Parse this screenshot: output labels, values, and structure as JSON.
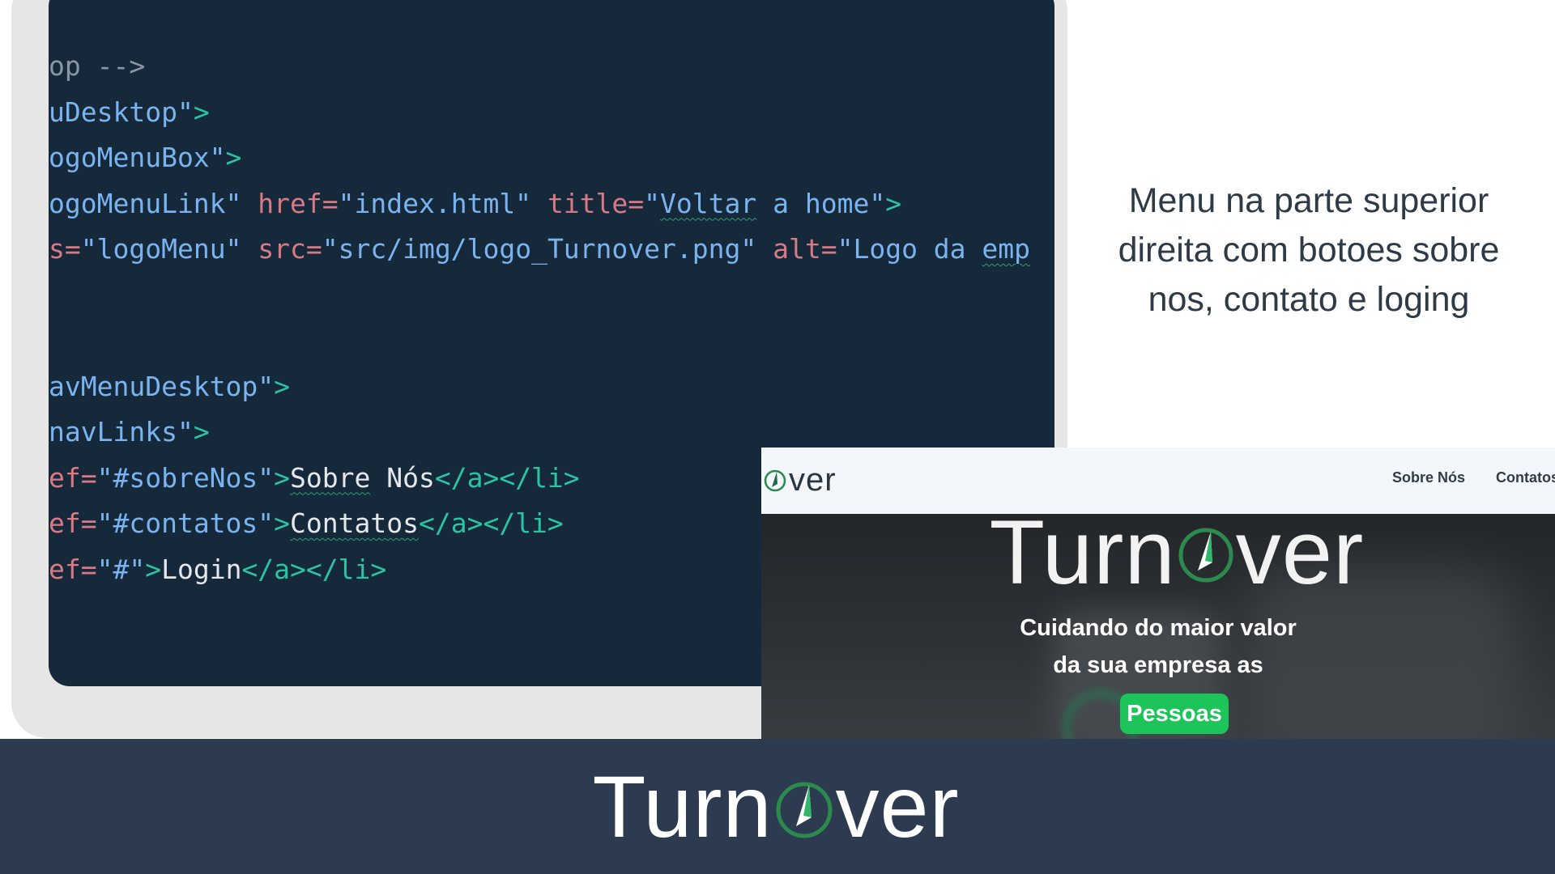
{
  "code_editor": {
    "lines": [
      [
        {
          "t": "comment",
          "v": "op -->"
        }
      ],
      [
        {
          "t": "str",
          "v": "uDesktop\""
        },
        {
          "t": "tag",
          "v": ">"
        }
      ],
      [
        {
          "t": "str",
          "v": "ogoMenuBox\""
        },
        {
          "t": "tag",
          "v": ">"
        }
      ],
      [
        {
          "t": "str",
          "v": "ogoMenuLink\""
        },
        {
          "t": "text",
          "v": " "
        },
        {
          "t": "attr",
          "v": "href="
        },
        {
          "t": "str",
          "v": "\"index.html\""
        },
        {
          "t": "text",
          "v": " "
        },
        {
          "t": "attr",
          "v": "title="
        },
        {
          "t": "str",
          "v": "\""
        },
        {
          "t": "str",
          "v": "Voltar",
          "sq": true
        },
        {
          "t": "str",
          "v": " a home\""
        },
        {
          "t": "tag",
          "v": ">"
        }
      ],
      [
        {
          "t": "attr",
          "v": "s="
        },
        {
          "t": "str",
          "v": "\"logoMenu\""
        },
        {
          "t": "text",
          "v": " "
        },
        {
          "t": "attr",
          "v": "src="
        },
        {
          "t": "str",
          "v": "\"src/img/logo_Turnover.png\""
        },
        {
          "t": "text",
          "v": " "
        },
        {
          "t": "attr",
          "v": "alt="
        },
        {
          "t": "str",
          "v": "\"Logo da "
        },
        {
          "t": "str",
          "v": "emp",
          "sq": true
        }
      ],
      [],
      [],
      [
        {
          "t": "str",
          "v": "avMenuDesktop\""
        },
        {
          "t": "tag",
          "v": ">"
        }
      ],
      [
        {
          "t": "str",
          "v": "navLinks\""
        },
        {
          "t": "tag",
          "v": ">"
        }
      ],
      [
        {
          "t": "attr",
          "v": "ef="
        },
        {
          "t": "str",
          "v": "\"#sobreNos\""
        },
        {
          "t": "tag",
          "v": ">"
        },
        {
          "t": "text",
          "v": "Sobre",
          "sq": true
        },
        {
          "t": "text",
          "v": " Nós"
        },
        {
          "t": "tag",
          "v": "</a></li>"
        }
      ],
      [
        {
          "t": "attr",
          "v": "ef="
        },
        {
          "t": "str",
          "v": "\"#contatos\""
        },
        {
          "t": "tag",
          "v": ">"
        },
        {
          "t": "text",
          "v": "Contatos",
          "sq": true
        },
        {
          "t": "tag",
          "v": "</a></li>"
        }
      ],
      [
        {
          "t": "attr",
          "v": "ef="
        },
        {
          "t": "str",
          "v": "\"#\""
        },
        {
          "t": "tag",
          "v": ">"
        },
        {
          "t": "text",
          "v": "Login"
        },
        {
          "t": "tag",
          "v": "</a></li>"
        }
      ]
    ]
  },
  "description": {
    "line1": "Menu na parte superior",
    "line2": "direita com botoes sobre",
    "line3": "nos, contato e loging"
  },
  "preview": {
    "nav_logo_text": "ver",
    "nav_links": [
      "Sobre Nós",
      "Contatos"
    ],
    "hero_logo_left": "Turn",
    "hero_logo_right": "ver",
    "tagline_line1": "Cuidando do maior valor",
    "tagline_line2": "da sua empresa as",
    "highlight": "Pessoas",
    "highlight_color": "#1cc45a"
  },
  "footer": {
    "brand_left": "Turn",
    "brand_right": "ver",
    "background": "#2d3b50"
  },
  "icons": {
    "logo_mark": "compass-o-icon"
  },
  "colors": {
    "code_background": "#16293a",
    "accent_green": "#2c8a4e",
    "text_dark": "#2e3a46"
  }
}
